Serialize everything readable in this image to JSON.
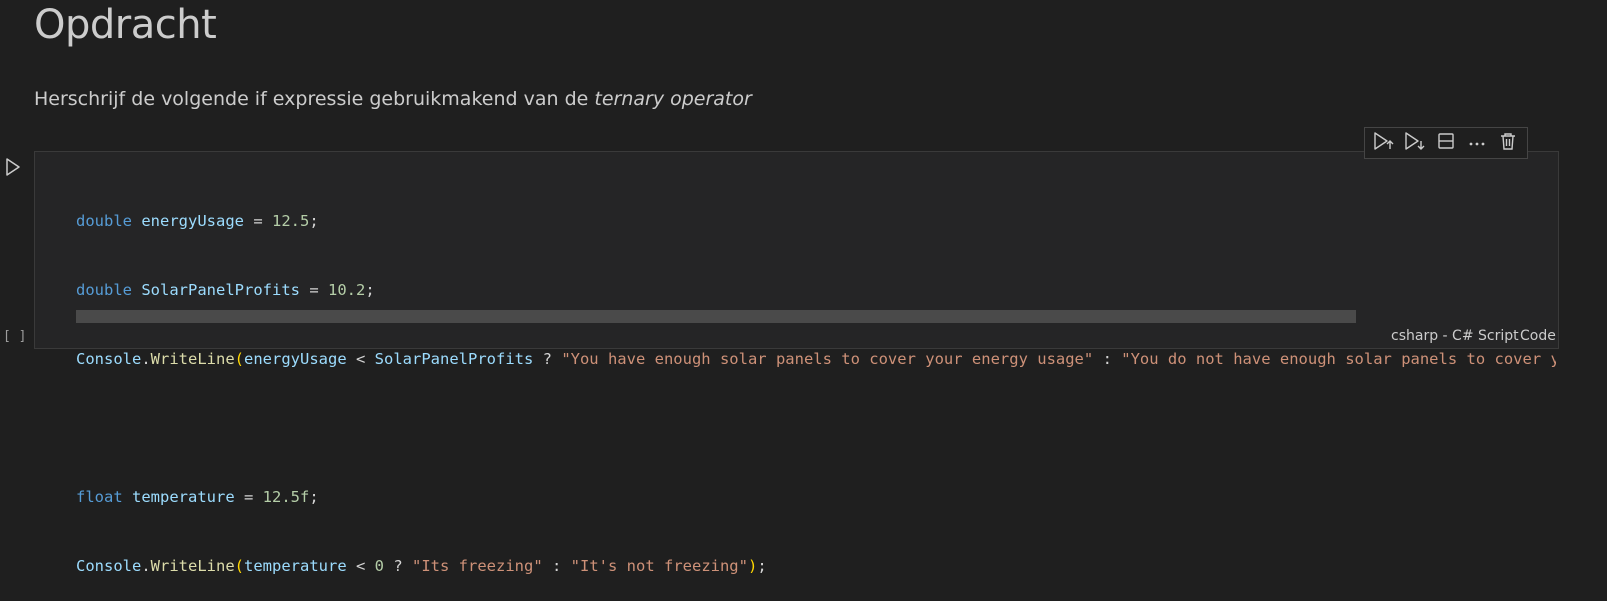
{
  "markdown": {
    "title": "Opdracht",
    "paragraph_plain": "Herschrijf de volgende if expressie gebruikmakend van de ",
    "paragraph_italic": "ternary operator"
  },
  "cell": {
    "execution_count": "[ ]",
    "language_label": "csharp - C# Script",
    "cell_type_label": "Code",
    "toolbar": [
      "run-above-icon",
      "run-below-icon",
      "split-cell-icon",
      "more-icon",
      "trash-icon"
    ],
    "code": {
      "l1": {
        "kw": "double",
        "var": "energyUsage",
        "op": " = ",
        "num": "12.5",
        "end": ";"
      },
      "l2": {
        "kw": "double",
        "var": "SolarPanelProfits",
        "op": " = ",
        "num": "10.2",
        "end": ";"
      },
      "l3": {
        "cls": "Console",
        "dot": ".",
        "fn": "WriteLine",
        "open": "(",
        "var1": "energyUsage",
        "lt": " < ",
        "var2": "SolarPanelProfits",
        "q": " ? ",
        "str1": "\"You have enough solar panels to cover your energy usage\"",
        "colon": " : ",
        "str2": "\"You do not have enough solar panels to cover your energy usage\""
      },
      "l5": {
        "kw": "float",
        "var": "temperature",
        "op": " = ",
        "num": "12.5f",
        "end": ";"
      },
      "l6": {
        "cls": "Console",
        "dot": ".",
        "fn": "WriteLine",
        "open": "(",
        "var": "temperature",
        "lt": " < ",
        "num": "0",
        "q": " ? ",
        "str1": "\"Its freezing\"",
        "colon": " : ",
        "str2": "\"It's not freezing\"",
        "close": ")",
        "end": ";"
      }
    }
  },
  "colors": {
    "background": "#1f1f1f",
    "keyword": "#569cd6",
    "variable": "#9cdcfe",
    "number": "#b5cea8",
    "string": "#ce9178",
    "function": "#dcdcaa",
    "class": "#4ec9b0"
  }
}
